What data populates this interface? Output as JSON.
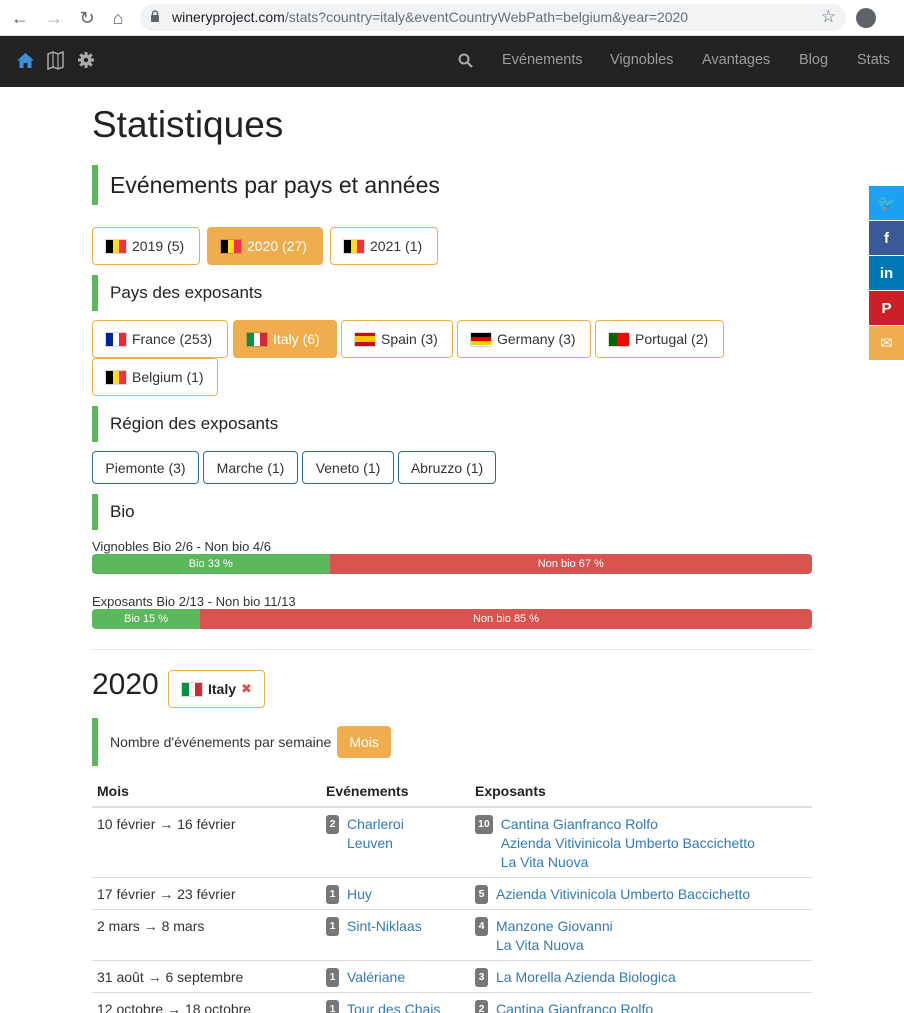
{
  "browser": {
    "url_host": "wineryproject.com",
    "url_rest": "/stats?country=italy&eventCountryWebPath=belgium&year=2020"
  },
  "navbar": {
    "links": [
      "Evénements",
      "Vignobles",
      "Avantages",
      "Blog",
      "Stats"
    ]
  },
  "page": {
    "title": "Statistiques",
    "section_events": "Evénements par pays et années",
    "years": [
      {
        "label": "2019 (5)",
        "flag": "be",
        "active": false
      },
      {
        "label": "2020 (27)",
        "flag": "be",
        "active": true
      },
      {
        "label": "2021 (1)",
        "flag": "be",
        "active": false
      }
    ],
    "section_countries": "Pays des exposants",
    "countries": [
      {
        "label": "France (253)",
        "flag": "fr",
        "active": false
      },
      {
        "label": "Italy (6)",
        "flag": "it",
        "active": true
      },
      {
        "label": "Spain (3)",
        "flag": "es",
        "active": false
      },
      {
        "label": "Germany (3)",
        "flag": "de",
        "active": false
      },
      {
        "label": "Portugal (2)",
        "flag": "pt",
        "active": false
      },
      {
        "label": "Belgium (1)",
        "flag": "be",
        "active": false
      }
    ],
    "section_regions": "Région des exposants",
    "regions": [
      "Piemonte (3)",
      "Marche (1)",
      "Veneto (1)",
      "Abruzzo (1)"
    ],
    "section_bio": "Bio",
    "bio_vineyards": {
      "label": "Vignobles Bio 2/6 - Non bio 4/6",
      "bio_text": "Bio 33 %",
      "nonbio_text": "Non bio 67 %",
      "bio_pct": 33
    },
    "bio_exhibitors": {
      "label": "Exposants Bio 2/13 - Non bio 11/13",
      "bio_text": "Bio 15 %",
      "nonbio_text": "Non bio 85 %",
      "bio_pct": 15
    },
    "year": "2020",
    "country_chip": "Italy",
    "country_chip_remove": "✖",
    "week_label": "Nombre d'événements par semaine",
    "mois_button": "Mois",
    "table": {
      "headers": [
        "Mois",
        "Evénements",
        "Exposants"
      ],
      "rows": [
        {
          "period": "10 février → 16 février",
          "event_count": "2",
          "events": [
            "Charleroi",
            "Leuven"
          ],
          "exhibitor_count": "10",
          "exhibitors": [
            "Cantina Gianfranco Rolfo",
            "Azienda Vitivinicola Umberto Baccichetto",
            "La Vita Nuova"
          ]
        },
        {
          "period": "17 février → 23 février",
          "event_count": "1",
          "events": [
            "Huy"
          ],
          "exhibitor_count": "5",
          "exhibitors": [
            "Azienda Vitivinicola Umberto Baccichetto"
          ]
        },
        {
          "period": "2 mars → 8 mars",
          "event_count": "1",
          "events": [
            "Sint-Niklaas"
          ],
          "exhibitor_count": "4",
          "exhibitors": [
            "Manzone Giovanni",
            "La Vita Nuova"
          ]
        },
        {
          "period": "31 août → 6 septembre",
          "event_count": "1",
          "events": [
            "Valériane"
          ],
          "exhibitor_count": "3",
          "exhibitors": [
            "La Morella Azienda Biologica"
          ]
        },
        {
          "period": "12 octobre → 18 octobre",
          "event_count": "1",
          "events": [
            "Tour des Chais"
          ],
          "exhibitor_count": "2",
          "exhibitors": [
            "Cantina Gianfranco Rolfo"
          ]
        }
      ]
    }
  },
  "share": [
    {
      "name": "twitter-share-button",
      "icon": "twitter-icon",
      "glyph": "🐦",
      "color": "#1da1f2"
    },
    {
      "name": "facebook-share-button",
      "icon": "facebook-icon",
      "glyph": "f",
      "color": "#3b5998"
    },
    {
      "name": "linkedin-share-button",
      "icon": "linkedin-icon",
      "glyph": "in",
      "color": "#0077b5"
    },
    {
      "name": "pinterest-share-button",
      "icon": "pinterest-icon",
      "glyph": "P",
      "color": "#cb2027"
    },
    {
      "name": "email-share-button",
      "icon": "email-icon",
      "glyph": "✉",
      "color": "#f0ad4e"
    }
  ],
  "colors": {
    "accent": "#f0ad4e",
    "green": "#5cb85c",
    "red": "#d9534f",
    "link": "#337ab7"
  }
}
